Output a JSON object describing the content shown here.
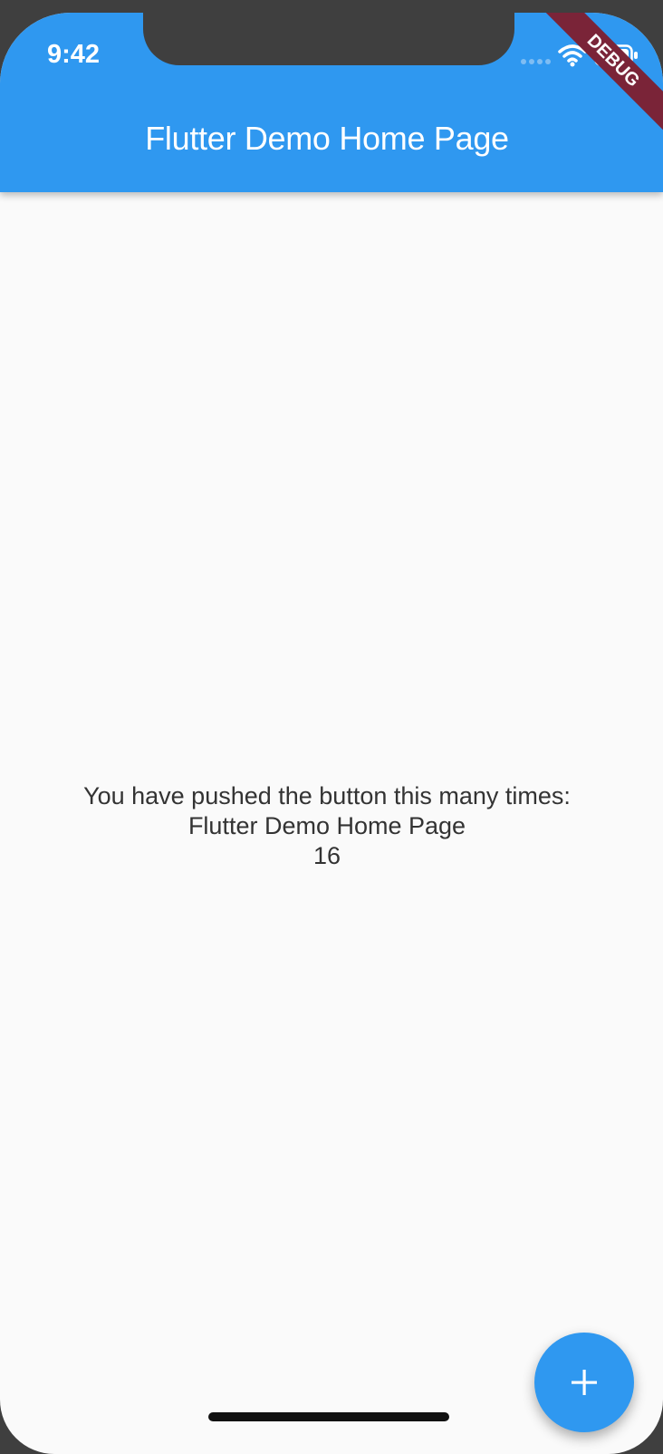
{
  "status_bar": {
    "time": "9:42",
    "icons": [
      "signal-icon",
      "wifi-icon",
      "battery-icon"
    ]
  },
  "app_bar": {
    "title": "Flutter Demo Home Page"
  },
  "debug_banner": {
    "label": "DEBUG"
  },
  "body": {
    "message": "You have pushed the button this many times:",
    "title_echo": "Flutter Demo Home Page",
    "counter": "16"
  },
  "fab": {
    "icon": "plus-icon"
  },
  "colors": {
    "primary": "#2f98f0",
    "background": "#fafafa",
    "banner": "#7a2438",
    "text": "#333333"
  }
}
